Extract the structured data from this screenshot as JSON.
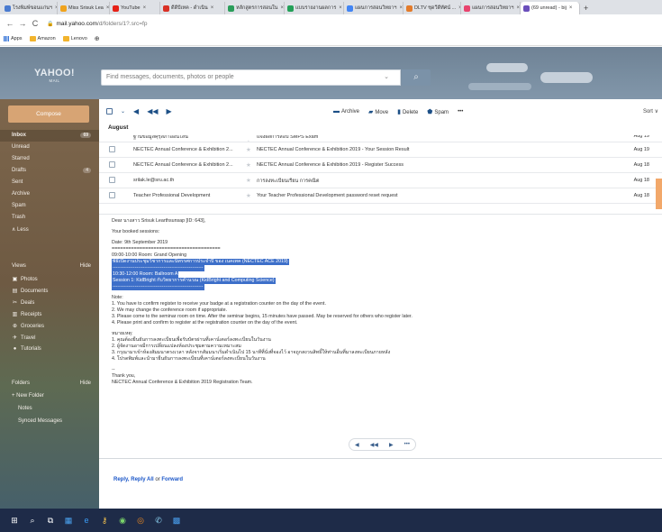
{
  "browser": {
    "tabs": [
      {
        "label": "โรงพิมพ์ขอนแก่นฯ",
        "color": "#4a7bd0",
        "active": false
      },
      {
        "label": "Miss Srisuk Lea",
        "color": "#f0a31d",
        "active": false
      },
      {
        "label": "YouTube",
        "color": "#e62117",
        "active": false
      },
      {
        "label": "ดีดีบีเทค - ดำเนิน",
        "color": "#d93025",
        "active": false
      },
      {
        "label": "หลักสูตรการสอนใน",
        "color": "#2a9d5a",
        "active": false
      },
      {
        "label": "แบบรายงานผลการ",
        "color": "#23a058",
        "active": false
      },
      {
        "label": "แผนการสอนวิทยาฯ",
        "color": "#4285f4",
        "active": false
      },
      {
        "label": "DLTV ชุดวีดีทัศน์ ...",
        "color": "#e37b2b",
        "active": false
      },
      {
        "label": "แผนการสอนวิทยาฯ",
        "color": "#e8436e",
        "active": false
      },
      {
        "label": "(69 unread) - bij",
        "color": "#6b4fbb",
        "active": true
      }
    ],
    "new_tab": "+",
    "back": "←",
    "forward": "→",
    "reload": "C",
    "url_host": "mail.yahoo.com",
    "url_path": "/d/folders/1?.src=fp",
    "bookmarks": [
      "Apps",
      "Amazon",
      "Lenovo"
    ]
  },
  "header": {
    "logo": "YAHOO!",
    "logo_sub": "MAIL",
    "search_placeholder": "Find messages, documents, photos or people",
    "search_chevron": "⌄",
    "search_icon": "⌕"
  },
  "sidebar": {
    "compose": "Compose",
    "items": [
      {
        "label": "Inbox",
        "count": "69",
        "bold": true
      },
      {
        "label": "Unread",
        "count": ""
      },
      {
        "label": "Starred",
        "count": ""
      },
      {
        "label": "Drafts",
        "count": "4"
      },
      {
        "label": "Sent",
        "count": ""
      },
      {
        "label": "Archive",
        "count": ""
      },
      {
        "label": "Spam",
        "count": ""
      },
      {
        "label": "Trash",
        "count": ""
      },
      {
        "label": "∧ Less",
        "count": ""
      }
    ],
    "views_label": "Views",
    "views_action": "Hide",
    "views": [
      {
        "label": "Photos",
        "icon": "▣"
      },
      {
        "label": "Documents",
        "icon": "▤"
      },
      {
        "label": "Deals",
        "icon": "✂"
      },
      {
        "label": "Receipts",
        "icon": "▥"
      },
      {
        "label": "Groceries",
        "icon": "⊕"
      },
      {
        "label": "Travel",
        "icon": "✈"
      },
      {
        "label": "Tutorials",
        "icon": "●"
      }
    ],
    "folders_label": "Folders",
    "folders_action": "Hide",
    "folders": [
      {
        "label": "+ New Folder"
      },
      {
        "label": "Notes"
      },
      {
        "label": "Synced Messages"
      }
    ]
  },
  "toolbar": {
    "archive": "Archive",
    "move": "Move",
    "delete": "Delete",
    "spam": "Spam",
    "more": "•••",
    "sort": "Sort ∨"
  },
  "list": {
    "month": "August",
    "rows": [
      {
        "from": "ฐานข้อมูลคุรุสภาออนไลน์",
        "subject": "แจ้งผลการสอบ SMPS Exam",
        "date": "Aug 19",
        "partial": true
      },
      {
        "from": "NECTEC Annual Conference & Exhibition 2...",
        "subject": "NECTEC Annual Conference & Exhibition 2019 - Your Session Result",
        "date": "Aug 19",
        "partial": false
      },
      {
        "from": "NECTEC Annual Conference & Exhibition 2...",
        "subject": "NECTEC Annual Conference & Exhibition 2019 - Register Success",
        "date": "Aug 18",
        "partial": false
      },
      {
        "from": "srilak.le@sru.ac.th",
        "subject": "การลงทะเบียนเรียน การคณิต",
        "date": "Aug 18",
        "partial": false
      },
      {
        "from": "Teacher Professional Development",
        "subject": "Your Teacher Professional Development password reset request",
        "date": "Aug 18",
        "partial": false
      }
    ]
  },
  "email": {
    "lines": [
      {
        "t": "Dear นางสาว Srisuk Learthsunsap [ID: 643],",
        "hl": false
      },
      {
        "t": "",
        "hl": false
      },
      {
        "t": "Your booked sessions:",
        "hl": false
      },
      {
        "t": "",
        "hl": false
      },
      {
        "t": "Date: 9th September 2019",
        "hl": false
      },
      {
        "t": "=======================================",
        "hl": false
      },
      {
        "t": "09:00-10:00   Room: Grand Opening",
        "hl": false
      },
      {
        "t": "พิธีเปิดงานประชุมวิชาการและนิทรรศการประจำปี ของ เนคเทค (NECTEC ACE 2019)",
        "hl": true
      },
      {
        "t": "---------------------------------------------------------",
        "hl": true
      },
      {
        "t": "10:30-12:00   Room: Ballroom A",
        "hl": true
      },
      {
        "t": "Session 1: KidBright กับวิทยาการคำนวณ (KidBright and Computing Science)",
        "hl": true
      },
      {
        "t": "---------------------------------------------------------",
        "hl": true
      },
      {
        "t": "",
        "hl": false
      },
      {
        "t": "Note:",
        "hl": false
      },
      {
        "t": "1. You have to confirm register to receive your badge at a registration counter on the day of the event.",
        "hl": false
      },
      {
        "t": "2. We may change the conference room if appropriate.",
        "hl": false
      },
      {
        "t": "3. Please come to the seminar room on time. After the seminar begins, 15 minutes have passed. May be reserved for others who register later.",
        "hl": false
      },
      {
        "t": "4. Please print and confirm to register at the registration counter on the day of the event.",
        "hl": false
      },
      {
        "t": "",
        "hl": false
      },
      {
        "t": "หมายเหตุ:",
        "hl": false
      },
      {
        "t": "1. คุณต้องยืนยันการลงทะเบียนเพื่อรับบัตรผ่านที่เคาน์เตอร์ลงทะเบียนในวันงาน",
        "hl": false
      },
      {
        "t": "2. ผู้จัดงานอาจมีการเปลี่ยนแปลงห้องประชุมตามความเหมาะสม",
        "hl": false
      },
      {
        "t": "3. กรุณามาเข้าห้องสัมมนาตรงเวลา หลังจากสัมมนาเริ่มดำเนินไป 15 นาทีที่นั่งที่จองไว้ อาจถูกสงวนสิทธิ์ให้ท่านอื่นที่มาลงทะเบียนภายหลัง",
        "hl": false
      },
      {
        "t": "4. โปรดพิมพ์และนำมายืนยันการลงทะเบียนที่เคาน์เตอร์ลงทะเบียนในวันงาน",
        "hl": false
      },
      {
        "t": "",
        "hl": false
      },
      {
        "t": "--",
        "hl": false
      },
      {
        "t": "Thank you,",
        "hl": false
      },
      {
        "t": "NECTEC Annual Conference & Exhibition 2019 Registration Team.",
        "hl": false
      }
    ],
    "actions": [
      "◀",
      "◀◀",
      "▶",
      "•••"
    ],
    "reply": "Reply",
    "reply_all": "Reply All",
    "or": "or",
    "forward": "Forward"
  },
  "taskbar": [
    "⊞",
    "⌕",
    "⧉",
    "▦",
    "e",
    "⚷",
    "◉",
    "◎",
    "✆",
    "▩"
  ]
}
